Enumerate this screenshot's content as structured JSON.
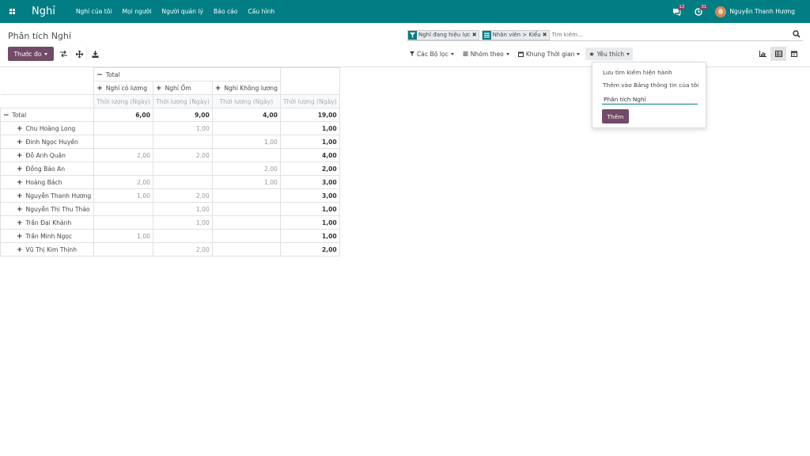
{
  "app": {
    "brand": "Nghỉ"
  },
  "menu": [
    "Nghỉ của tôi",
    "Mọi người",
    "Người quản lý",
    "Báo cáo",
    "Cấu hình"
  ],
  "topbar": {
    "messages_count": "12",
    "activities_count": "31",
    "user_name": "Nguyễn Thanh Hương"
  },
  "breadcrumb": "Phân tích Nghỉ",
  "search": {
    "facets": [
      {
        "icon": "filter-icon",
        "label": "Nghỉ đang hiệu lực"
      },
      {
        "icon": "groupby-icon",
        "label": "Nhân viên > Kiểu"
      }
    ],
    "placeholder": "Tìm kiếm..."
  },
  "toolbar": {
    "measures_label": "Thước đo",
    "filters_label": "Các Bộ lọc",
    "groupby_label": "Nhóm theo",
    "timeframe_label": "Khung Thời gian",
    "favorites_label": "Yêu thích"
  },
  "favorites_dropdown": {
    "save_current": "Lưu tìm kiếm hiện hành",
    "add_to_dashboard": "Thêm vào Bảng thông tin của tôi",
    "name_value": "Phân tích Nghỉ",
    "add_button": "Thêm"
  },
  "pivot": {
    "col_total_label": "Total",
    "columns": [
      "Nghỉ có lương",
      "Nghỉ Ốm",
      "Nghỉ Không lương"
    ],
    "measure": "Thời lượng (Ngày)",
    "total_row": {
      "label": "Total",
      "values": [
        "6,00",
        "9,00",
        "4,00",
        "19,00"
      ]
    },
    "rows": [
      {
        "label": "Chu Hoàng Long",
        "values": [
          "",
          "1,00",
          "",
          "1,00"
        ]
      },
      {
        "label": "Đinh Ngọc Huyền",
        "values": [
          "",
          "",
          "1,00",
          "1,00"
        ]
      },
      {
        "label": "Đỗ Anh Quân",
        "values": [
          "2,00",
          "2,00",
          "",
          "4,00"
        ]
      },
      {
        "label": "Đồng Bảo An",
        "values": [
          "",
          "",
          "2,00",
          "2,00"
        ]
      },
      {
        "label": "Hoàng Bách",
        "values": [
          "2,00",
          "",
          "1,00",
          "3,00"
        ]
      },
      {
        "label": "Nguyễn Thanh Hương",
        "values": [
          "1,00",
          "2,00",
          "",
          "3,00"
        ]
      },
      {
        "label": "Nguyễn Thị Thu Thảo",
        "values": [
          "",
          "1,00",
          "",
          "1,00"
        ]
      },
      {
        "label": "Trần Đại Khánh",
        "values": [
          "",
          "1,00",
          "",
          "1,00"
        ]
      },
      {
        "label": "Trần Minh Ngọc",
        "values": [
          "1,00",
          "",
          "",
          "1,00"
        ]
      },
      {
        "label": "Vũ Thị Kim Thịnh",
        "values": [
          "",
          "2,00",
          "",
          "2,00"
        ]
      }
    ]
  },
  "colors": {
    "navbar": "#017e84",
    "primary": "#714b67"
  }
}
